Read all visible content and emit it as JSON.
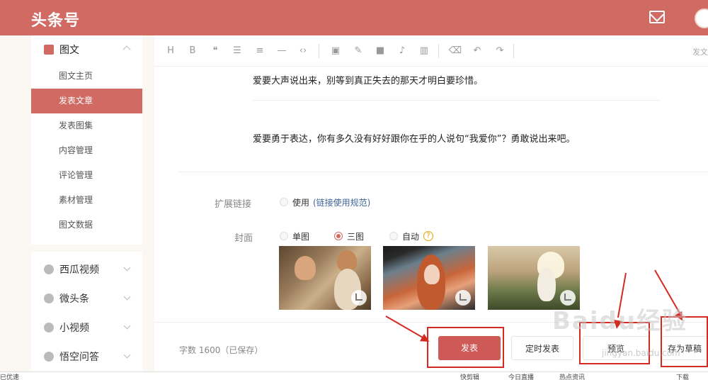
{
  "header": {
    "logo": "头条号"
  },
  "sidebar": {
    "group": {
      "title": "图文"
    },
    "items": [
      {
        "label": "图文主页"
      },
      {
        "label": "发表文章"
      },
      {
        "label": "发表图集"
      },
      {
        "label": "内容管理"
      },
      {
        "label": "评论管理"
      },
      {
        "label": "素材管理"
      },
      {
        "label": "图文数据"
      }
    ],
    "nav": [
      {
        "label": "西瓜视频"
      },
      {
        "label": "微头条"
      },
      {
        "label": "小视频"
      },
      {
        "label": "悟空问答"
      }
    ]
  },
  "toolbar": {
    "buttons": [
      "H",
      "B",
      "❝",
      "☰",
      "≡",
      "—",
      "‹›",
      "▣",
      "✎",
      "■",
      "♪",
      "▥",
      "⌫",
      "↶",
      "↷"
    ],
    "right_text": "发文"
  },
  "editor": {
    "para1": "爱要大声说出来，别等到真正失去的那天才明白要珍惜。",
    "para2": "爱要勇于表达，你有多久没有好好跟你在乎的人说句“我爱你”？勇敢说出来吧。"
  },
  "options": {
    "ext_link_label": "扩展链接",
    "ext_link_use": "使用",
    "ext_link_note": "(链接使用规范)",
    "cover_label": "封面",
    "cover_single": "单图",
    "cover_triple": "三图",
    "cover_auto": "自动",
    "help": "?"
  },
  "footer": {
    "wordcount": "字数 1600（已保存）",
    "publish": "发表",
    "schedule": "定时发表",
    "preview": "预览",
    "draft": "存为草稿"
  },
  "watermark": {
    "text": "Baidu经验",
    "sub": "jingyan.baidu.com"
  },
  "statusbar": {
    "left": "已优速",
    "items": [
      "快剪辑",
      "今日直播",
      "热点资讯",
      "下载"
    ]
  }
}
